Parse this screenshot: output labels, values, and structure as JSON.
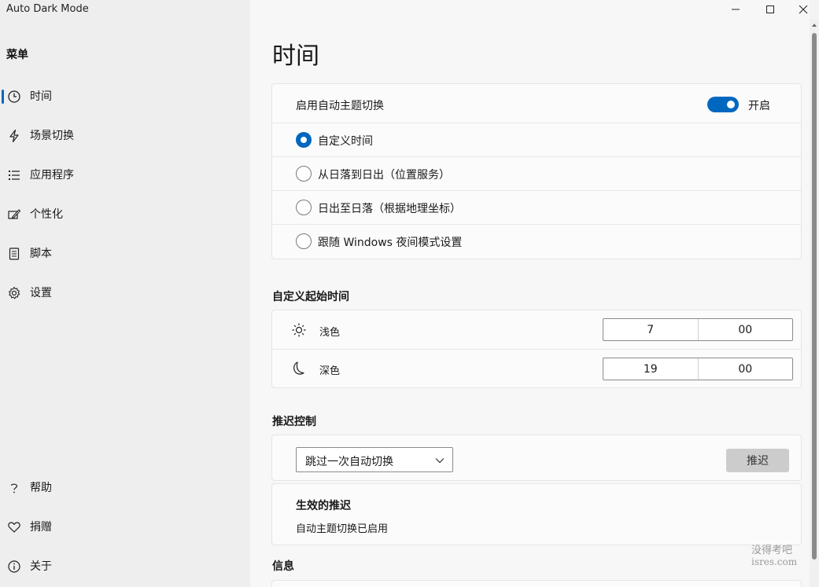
{
  "window": {
    "title": "Auto Dark Mode"
  },
  "sidebar": {
    "menu_title": "菜单",
    "items": [
      {
        "label": "时间",
        "icon": "clock-icon",
        "selected": true
      },
      {
        "label": "场景切换",
        "icon": "lightning-icon"
      },
      {
        "label": "应用程序",
        "icon": "list-icon"
      },
      {
        "label": "个性化",
        "icon": "personalize-icon"
      },
      {
        "label": "脚本",
        "icon": "document-icon"
      },
      {
        "label": "设置",
        "icon": "gear-icon"
      }
    ],
    "footer_items": [
      {
        "label": "帮助",
        "icon": "question-icon"
      },
      {
        "label": "捐赠",
        "icon": "heart-icon"
      },
      {
        "label": "关于",
        "icon": "info-icon"
      }
    ]
  },
  "main": {
    "page_title": "时间",
    "auto_switch": {
      "label": "启用自动主题切换",
      "state_text": "开启",
      "enabled": true
    },
    "mode_options": [
      {
        "label": "自定义时间",
        "checked": true
      },
      {
        "label": "从日落到日出（位置服务）",
        "checked": false
      },
      {
        "label": "日出至日落（根据地理坐标）",
        "checked": false
      },
      {
        "label": "跟随 Windows 夜间模式设置",
        "checked": false
      }
    ],
    "custom_start": {
      "section_title": "自定义起始时间",
      "light": {
        "label": "浅色",
        "icon": "sun-icon",
        "hour": "7",
        "minute": "00"
      },
      "dark": {
        "label": "深色",
        "icon": "moon-icon",
        "hour": "19",
        "minute": "00"
      }
    },
    "postpone": {
      "section_title": "推迟控制",
      "dropdown_value": "跳过一次自动切换",
      "button_label": "推迟",
      "active_title": "生效的推迟",
      "active_status": "自动主题切换已启用"
    },
    "info": {
      "section_title": "信息"
    }
  },
  "watermark": {
    "line1": "没得考吧",
    "line2": "isres.com"
  },
  "colors": {
    "accent": "#0067c0",
    "sidebar_bg": "#eeeeee",
    "main_bg": "#f7f7f7",
    "card_bg": "#fbfbfb"
  }
}
